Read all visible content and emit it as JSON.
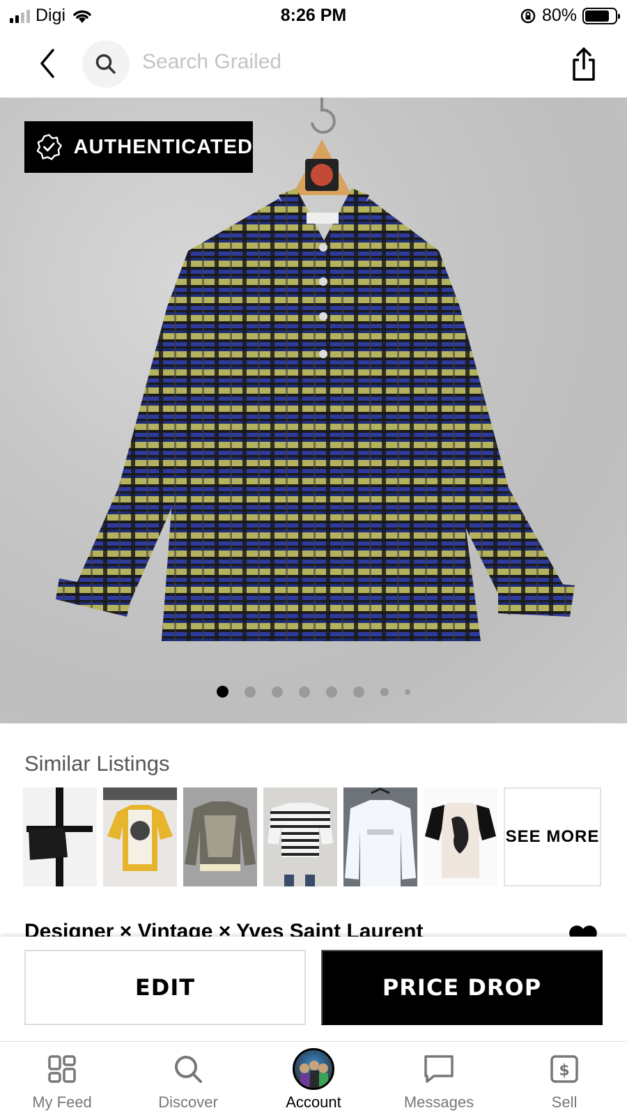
{
  "status_bar": {
    "carrier": "Digi",
    "time": "8:26 PM",
    "battery": "80%",
    "battery_level": 0.8
  },
  "header": {
    "search_placeholder": "Search Grailed"
  },
  "product": {
    "badge": "AUTHENTICATED",
    "image_count": 8,
    "active_image_index": 0
  },
  "similar": {
    "title": "Similar Listings",
    "see_more": "SEE MORE"
  },
  "listing": {
    "title": "Designer × Vintage × Yves Saint Laurent"
  },
  "actions": {
    "edit": "EDIT",
    "price_drop": "PRICE DROP"
  },
  "tabs": [
    {
      "label": "My Feed",
      "icon": "feed-icon"
    },
    {
      "label": "Discover",
      "icon": "search-icon"
    },
    {
      "label": "Account",
      "icon": "avatar"
    },
    {
      "label": "Messages",
      "icon": "chat-icon"
    },
    {
      "label": "Sell",
      "icon": "sell-icon"
    }
  ],
  "colors": {
    "accent": "#000000",
    "placeholder": "#c4c4c4"
  }
}
